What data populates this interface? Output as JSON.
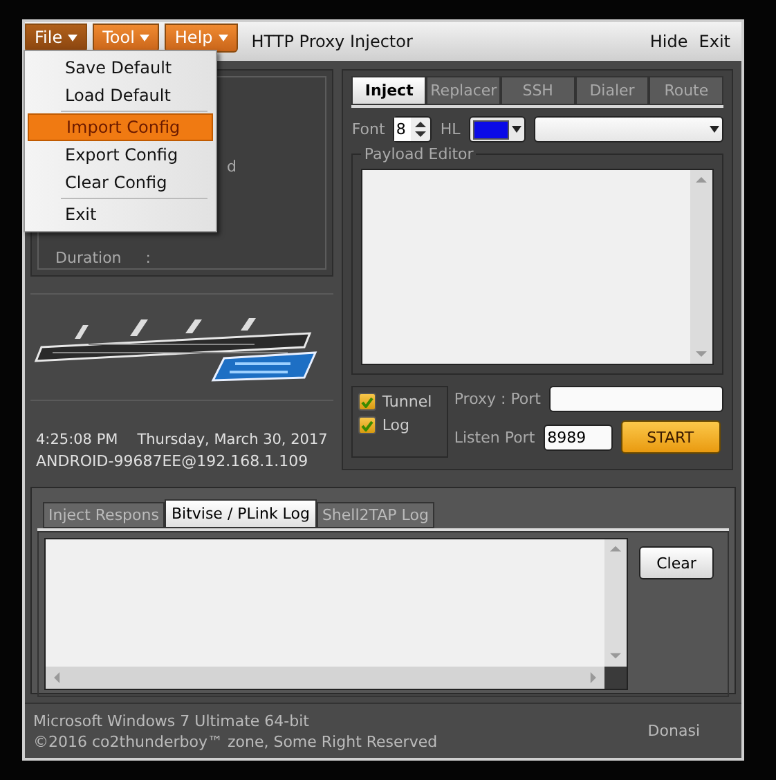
{
  "window": {
    "title": "HTTP Proxy Injector",
    "controls": [
      "Hide",
      "Exit"
    ]
  },
  "menu_bar": [
    {
      "label": "File",
      "selected": true
    },
    {
      "label": "Tool",
      "selected": false
    },
    {
      "label": "Help",
      "selected": false
    }
  ],
  "file_menu": [
    {
      "kind": "item",
      "label": "Save Default",
      "selected": false
    },
    {
      "kind": "item",
      "label": "Load Default",
      "selected": false
    },
    {
      "kind": "separator"
    },
    {
      "kind": "item",
      "label": "Import Config",
      "selected": true
    },
    {
      "kind": "item",
      "label": "Export Config",
      "selected": false
    },
    {
      "kind": "item",
      "label": "Clear Config",
      "selected": false
    },
    {
      "kind": "separator"
    },
    {
      "kind": "item",
      "label": "Exit",
      "selected": false
    }
  ],
  "status_panel": {
    "partial_text": "d",
    "duration_label": "Duration",
    "duration_value": ":"
  },
  "clock": {
    "time": "4:25:08 PM",
    "date": "Thursday, March 30, 2017"
  },
  "host": "ANDROID-99687EE@192.168.1.109",
  "main_tabs": [
    {
      "label": "Inject",
      "selected": true
    },
    {
      "label": "Replacer",
      "selected": false
    },
    {
      "label": "SSH",
      "selected": false
    },
    {
      "label": "Dialer",
      "selected": false
    },
    {
      "label": "Route",
      "selected": false
    }
  ],
  "font": {
    "label": "Font",
    "value": "8"
  },
  "highlight": {
    "label": "HL",
    "color": "#0a0ae6"
  },
  "payload_editor": {
    "title": "Payload Editor"
  },
  "options": [
    {
      "label": "Tunnel",
      "checked": true
    },
    {
      "label": "Log",
      "checked": true
    }
  ],
  "proxy": {
    "label": "Proxy : Port"
  },
  "listen_port": {
    "label": "Listen Port",
    "value": "8989"
  },
  "start_button": "START",
  "log_tabs": [
    {
      "label": "Inject Respons",
      "selected": false
    },
    {
      "label": "Bitvise / PLink Log",
      "selected": true
    },
    {
      "label": "Shell2TAP Log",
      "selected": false
    }
  ],
  "clear_button": "Clear",
  "footer": {
    "system": "Microsoft Windows 7 Ultimate  64-bit",
    "copyright": "©2016  co2thunderboy™ zone, Some Right Reserved",
    "donate": "Donasi"
  }
}
